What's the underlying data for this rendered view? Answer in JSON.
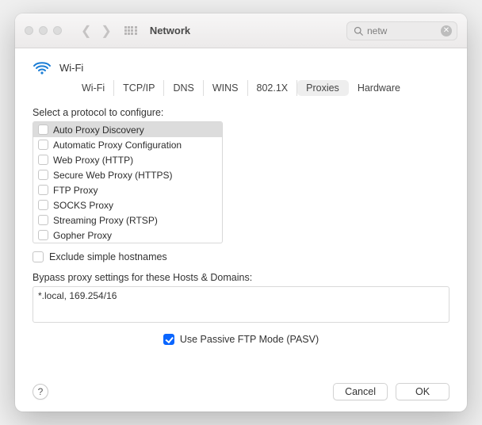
{
  "titlebar": {
    "title": "Network",
    "search_value": "netw"
  },
  "interface": {
    "name": "Wi-Fi"
  },
  "tabs": [
    {
      "label": "Wi-Fi"
    },
    {
      "label": "TCP/IP"
    },
    {
      "label": "DNS"
    },
    {
      "label": "WINS"
    },
    {
      "label": "802.1X"
    },
    {
      "label": "Proxies"
    },
    {
      "label": "Hardware"
    }
  ],
  "proxies": {
    "select_label": "Select a protocol to configure:",
    "protocols": [
      {
        "label": "Auto Proxy Discovery",
        "checked": false,
        "selected": true
      },
      {
        "label": "Automatic Proxy Configuration",
        "checked": false,
        "selected": false
      },
      {
        "label": "Web Proxy (HTTP)",
        "checked": false,
        "selected": false
      },
      {
        "label": "Secure Web Proxy (HTTPS)",
        "checked": false,
        "selected": false
      },
      {
        "label": "FTP Proxy",
        "checked": false,
        "selected": false
      },
      {
        "label": "SOCKS Proxy",
        "checked": false,
        "selected": false
      },
      {
        "label": "Streaming Proxy (RTSP)",
        "checked": false,
        "selected": false
      },
      {
        "label": "Gopher Proxy",
        "checked": false,
        "selected": false
      }
    ],
    "exclude_label": "Exclude simple hostnames",
    "exclude_checked": false,
    "bypass_label": "Bypass proxy settings for these Hosts & Domains:",
    "bypass_value": "*.local, 169.254/16",
    "pasv_label": "Use Passive FTP Mode (PASV)",
    "pasv_checked": true
  },
  "buttons": {
    "help": "?",
    "cancel": "Cancel",
    "ok": "OK"
  }
}
